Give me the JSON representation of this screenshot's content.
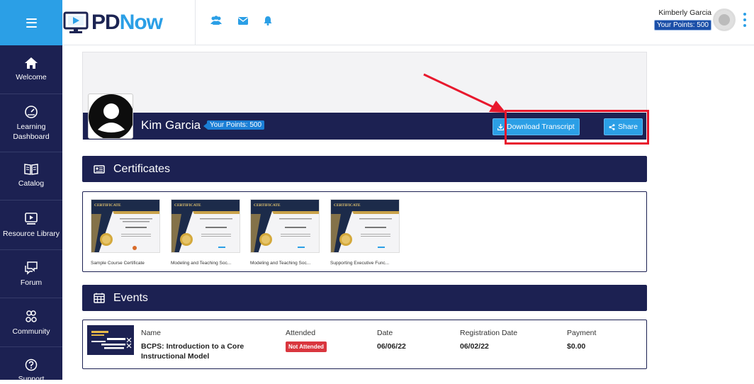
{
  "app": {
    "logo_pd": "PD",
    "logo_now": "Now"
  },
  "topbar": {
    "user_name": "Kimberly Garcia",
    "points_label": "Your Points: 500",
    "icons": [
      "users-icon",
      "mail-icon",
      "bell-icon"
    ]
  },
  "sidebar": {
    "items": [
      {
        "label": "Welcome",
        "icon": "home-icon"
      },
      {
        "label": "Learning Dashboard",
        "icon": "dashboard-icon"
      },
      {
        "label": "Catalog",
        "icon": "book-icon"
      },
      {
        "label": "Resource Library",
        "icon": "monitor-icon"
      },
      {
        "label": "Forum",
        "icon": "chat-icon"
      },
      {
        "label": "Community",
        "icon": "community-icon"
      },
      {
        "label": "Support",
        "icon": "help-icon"
      }
    ]
  },
  "profile": {
    "name": "Kim Garcia",
    "points_label": "Your Points: 500",
    "download_label": "Download Transcript",
    "share_label": "Share"
  },
  "certificates": {
    "title": "Certificates",
    "items": [
      {
        "caption": "Sample Course Certificate",
        "heading": "CERTIFICATE"
      },
      {
        "caption": "Modeling and Teaching Soc...",
        "heading": "CERTIFICATE"
      },
      {
        "caption": "Modeling and Teaching Soc...",
        "heading": "CERTIFICATE"
      },
      {
        "caption": "Supporting Executive Func...",
        "heading": "CERTIFICATE"
      }
    ]
  },
  "events": {
    "title": "Events",
    "columns": {
      "name": "Name",
      "attended": "Attended",
      "date": "Date",
      "registration_date": "Registration Date",
      "payment": "Payment"
    },
    "rows": [
      {
        "name_line1": "BCPS: Introduction to a Core",
        "name_line2": "Instructional Model",
        "attended": "Not Attended",
        "date": "06/06/22",
        "registration_date": "06/02/22",
        "payment": "$0.00"
      }
    ]
  },
  "colors": {
    "navy": "#1c2152",
    "accent": "#2b9fe6",
    "highlight": "#e8182d",
    "danger": "#d9363e"
  }
}
